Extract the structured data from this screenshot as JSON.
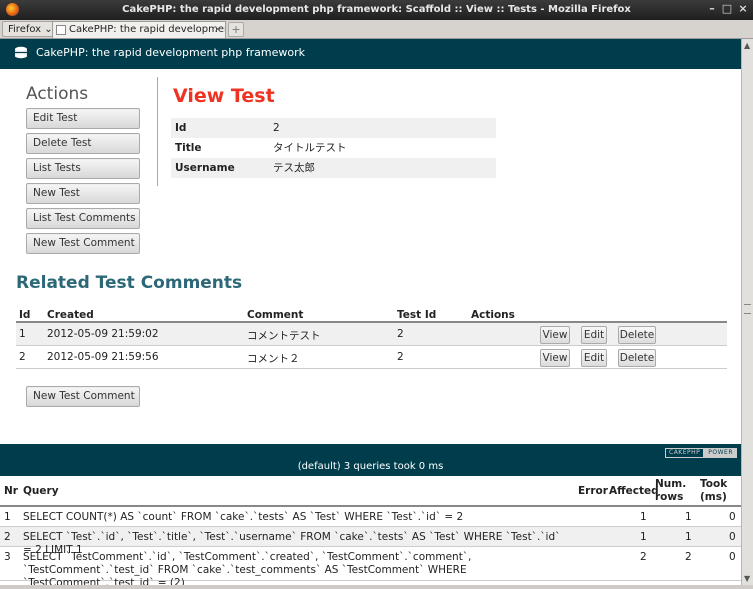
{
  "window": {
    "title": "CakePHP: the rapid development php framework: Scaffold :: View :: Tests - Mozilla Firefox",
    "firefox_menu": "Firefox",
    "tab_title": "CakePHP: the rapid development p...",
    "new_tab": "+"
  },
  "header": {
    "site_title": "CakePHP: the rapid development php framework"
  },
  "actions": {
    "heading": "Actions",
    "buttons": [
      "Edit Test",
      "Delete Test",
      "List Tests",
      "New Test",
      "List Test Comments",
      "New Test Comment"
    ]
  },
  "view": {
    "title": "View Test",
    "fields": [
      {
        "key": "Id",
        "value": "2"
      },
      {
        "key": "Title",
        "value": "タイトルテスト"
      },
      {
        "key": "Username",
        "value": "テス太郎"
      }
    ]
  },
  "related": {
    "title": "Related Test Comments",
    "columns": [
      "Id",
      "Created",
      "Comment",
      "Test Id",
      "Actions"
    ],
    "rows": [
      {
        "id": "1",
        "created": "2012-05-09 21:59:02",
        "comment": "コメントテスト",
        "test_id": "2"
      },
      {
        "id": "2",
        "created": "2012-05-09 21:59:56",
        "comment": "コメント２",
        "test_id": "2"
      }
    ],
    "row_buttons": {
      "view": "View",
      "edit": "Edit",
      "delete": "Delete"
    },
    "new_button": "New Test Comment"
  },
  "sql_log": {
    "powered_left": "CAKEPHP",
    "powered_right": "POWER",
    "summary": "(default) 3 queries took 0 ms",
    "columns": {
      "nr": "Nr",
      "query": "Query",
      "error": "Error",
      "affected": "Affected",
      "rows": "Num. rows",
      "took": "Took (ms)"
    },
    "rows": [
      {
        "nr": "1",
        "query": "SELECT COUNT(*) AS `count` FROM `cake`.`tests` AS `Test` WHERE `Test`.`id` = 2",
        "error": "",
        "affected": "1",
        "rows": "1",
        "took": "0"
      },
      {
        "nr": "2",
        "query": "SELECT `Test`.`id`, `Test`.`title`, `Test`.`username` FROM `cake`.`tests` AS `Test` WHERE `Test`.`id` = 2 LIMIT 1",
        "error": "",
        "affected": "1",
        "rows": "1",
        "took": "0"
      },
      {
        "nr": "3",
        "query": "SELECT `TestComment`.`id`, `TestComment`.`created`, `TestComment`.`comment`, `TestComment`.`test_id` FROM `cake`.`test_comments` AS `TestComment` WHERE `TestComment`.`test_id` = (2)",
        "error": "",
        "affected": "2",
        "rows": "2",
        "took": "0"
      }
    ]
  },
  "colors": {
    "header_bg": "#003d4c",
    "view_title": "#ee3322",
    "related_title": "#2c6877"
  }
}
